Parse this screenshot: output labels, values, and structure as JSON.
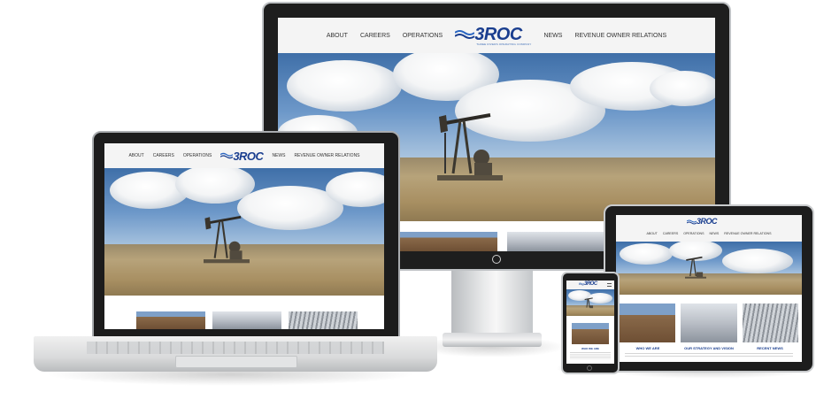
{
  "site": {
    "logo_word": "3ROC",
    "logo_tagline": "Three Rivers Operating Company",
    "nav_left": [
      "About",
      "Careers",
      "Operations"
    ],
    "nav_right": [
      "News",
      "Revenue Owner Relations"
    ]
  },
  "monitor": {
    "nav_left": [
      "ABOUT",
      "CAREERS",
      "OPERATIONS"
    ],
    "nav_right": [
      "NEWS",
      "REVENUE OWNER RELATIONS"
    ],
    "power_icon": "power-icon"
  },
  "laptop": {
    "nav_left": [
      "ABOUT",
      "CAREERS",
      "OPERATIONS"
    ],
    "nav_right": [
      "NEWS",
      "REVENUE OWNER RELATIONS"
    ]
  },
  "tablet": {
    "nav": [
      "ABOUT",
      "CAREERS",
      "OPERATIONS",
      "NEWS",
      "REVENUE OWNER RELATIONS"
    ],
    "captions": [
      "WHO WE ARE",
      "OUR STRATEGY AND VISION",
      "RECENT NEWS"
    ]
  },
  "phone": {
    "caption": "WHO WE ARE"
  },
  "colors": {
    "brand": "#1a3e8f",
    "nav_bg": "#f4f4f4",
    "bezel": "#1e1e1e"
  }
}
